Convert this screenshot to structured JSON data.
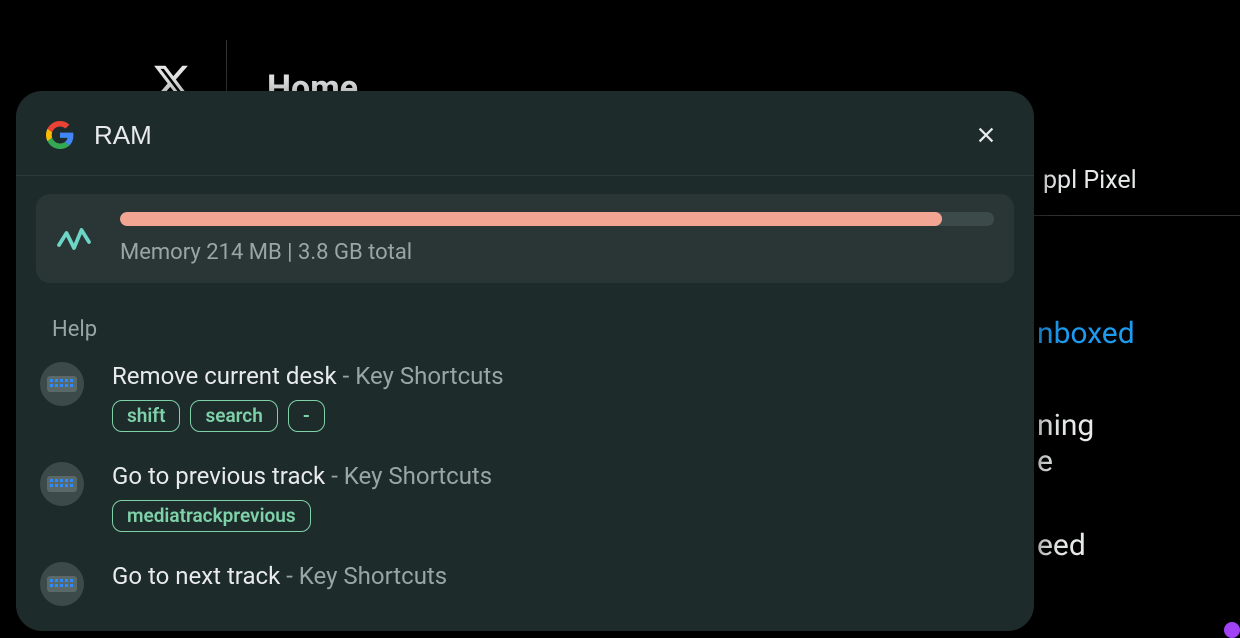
{
  "background": {
    "title": "Home",
    "tab_visible": "ppl Pixel",
    "link_fragment": "nboxed",
    "text_line1a": "ning",
    "text_line1b": "e",
    "text_line2": "eed"
  },
  "launcher": {
    "search_value": "RAM",
    "close_label": "Close",
    "memory": {
      "label": "Memory 214 MB | 3.8 GB total",
      "percent": 94
    },
    "section_label": "Help",
    "results": [
      {
        "title": "Remove current desk",
        "subtitle": " - Key Shortcuts",
        "keys": [
          "shift",
          "search",
          "-"
        ]
      },
      {
        "title": "Go to previous track",
        "subtitle": " - Key Shortcuts",
        "keys": [
          "mediatrackprevious"
        ]
      },
      {
        "title": "Go to next track",
        "subtitle": " - Key Shortcuts",
        "keys": []
      }
    ]
  }
}
